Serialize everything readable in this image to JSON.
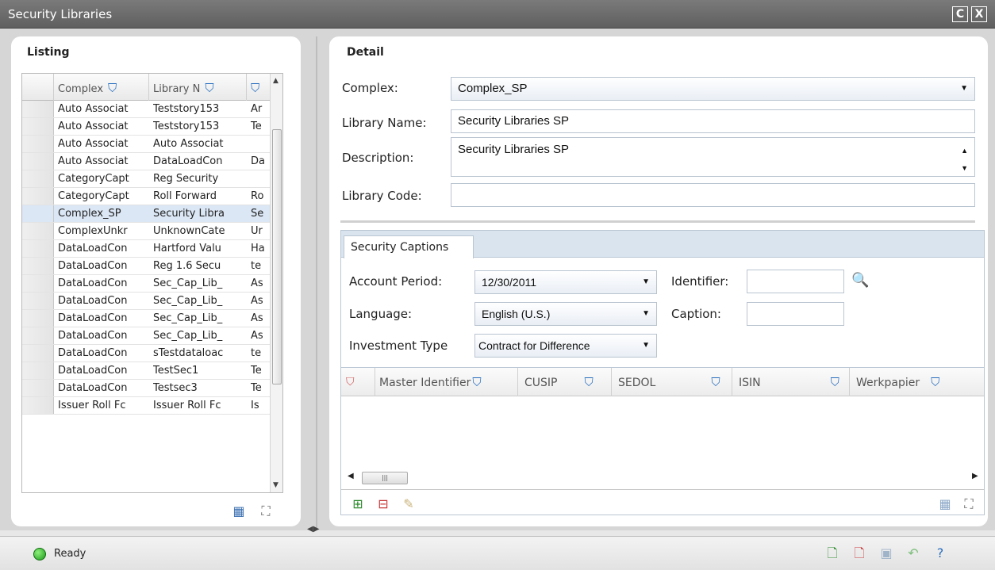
{
  "window": {
    "title": "Security Libraries",
    "restore_glyph": "C",
    "close_glyph": "X"
  },
  "listing": {
    "title": "Listing",
    "columns": [
      "Complex",
      "Library N",
      ""
    ],
    "rows": [
      [
        "Auto Associat",
        "Teststory153",
        "Ar"
      ],
      [
        "Auto Associat",
        "Teststory153",
        "Te"
      ],
      [
        "Auto Associat",
        "Auto Associat",
        ""
      ],
      [
        "Auto Associat",
        "DataLoadCon",
        "Da"
      ],
      [
        "CategoryCapt",
        "Reg Security",
        ""
      ],
      [
        "CategoryCapt",
        "Roll Forward",
        "Ro"
      ],
      [
        "Complex_SP",
        "Security Libra",
        "Se"
      ],
      [
        "ComplexUnkr",
        "UnknownCate",
        "Ur"
      ],
      [
        "DataLoadCon",
        "Hartford Valu",
        "Ha"
      ],
      [
        "DataLoadCon",
        "Reg 1.6 Secu",
        "te"
      ],
      [
        "DataLoadCon",
        "Sec_Cap_Lib_",
        "As"
      ],
      [
        "DataLoadCon",
        "Sec_Cap_Lib_",
        "As"
      ],
      [
        "DataLoadCon",
        "Sec_Cap_Lib_",
        "As"
      ],
      [
        "DataLoadCon",
        "Sec_Cap_Lib_",
        "As"
      ],
      [
        "DataLoadCon",
        "sTestdataloac",
        "te"
      ],
      [
        "DataLoadCon",
        "TestSec1",
        "Te"
      ],
      [
        "DataLoadCon",
        "Testsec3",
        "Te"
      ],
      [
        "Issuer Roll Fc",
        "Issuer Roll Fc",
        "Is"
      ]
    ],
    "selected_index": 6
  },
  "detail": {
    "title": "Detail",
    "complex_label": "Complex:",
    "complex_value": "Complex_SP",
    "library_name_label": "Library Name:",
    "library_name_value": "Security Libraries SP",
    "description_label": "Description:",
    "description_value": "Security Libraries SP",
    "library_code_label": "Library Code:",
    "library_code_value": "",
    "tab": "Security Captions",
    "account_period_label": "Account Period:",
    "account_period_value": "12/30/2011",
    "identifier_label": "Identifier:",
    "identifier_value": "",
    "language_label": "Language:",
    "language_value": "English (U.S.)",
    "caption_label": "Caption:",
    "caption_value": "",
    "investment_type_label": "Investment Type",
    "investment_type_value": "Contract for Difference",
    "captions_columns": [
      "Master Identifier",
      "CUSIP",
      "SEDOL",
      "ISIN",
      "Werkpapier"
    ]
  },
  "status": {
    "text": "Ready"
  },
  "colors": {
    "accent": "#2a6fbf",
    "selected_row": "#dbe7f5",
    "ready": "#1a9a1a"
  }
}
